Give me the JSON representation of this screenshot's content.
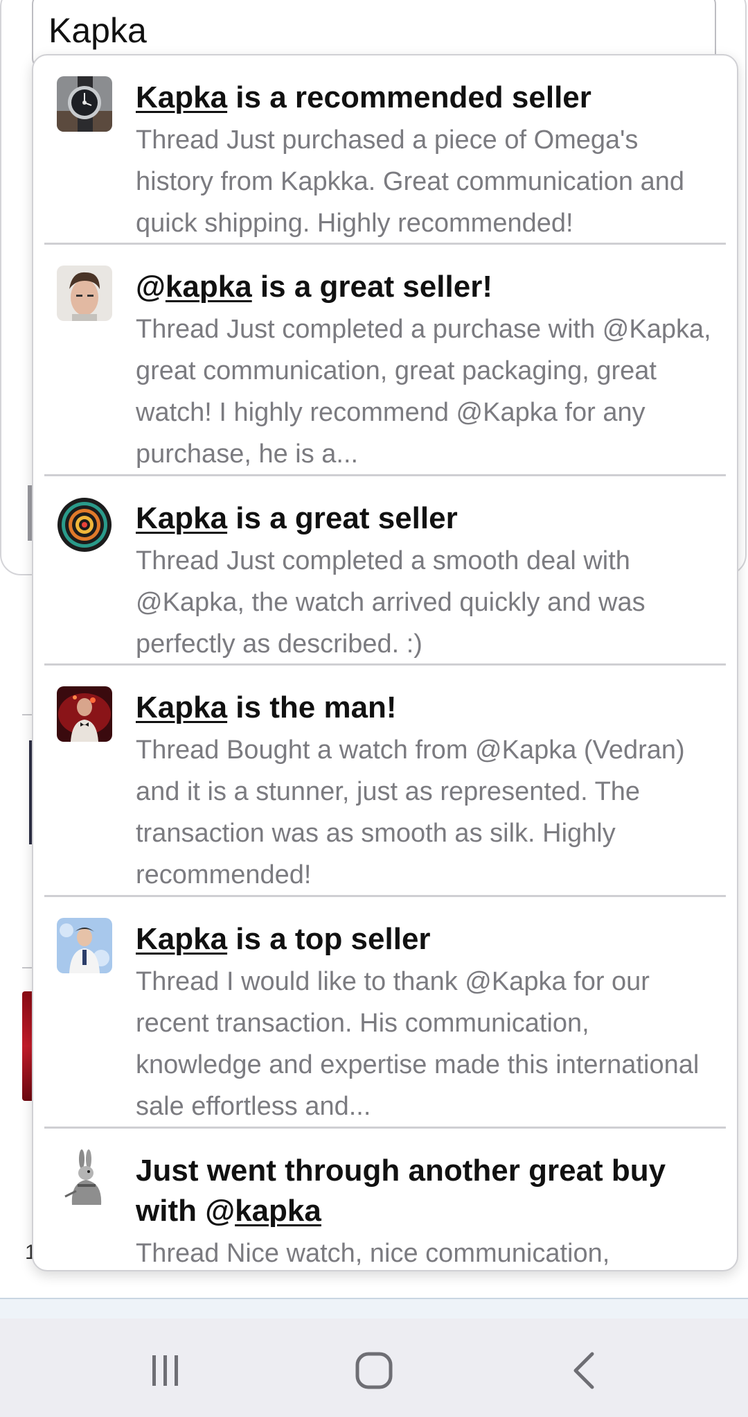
{
  "search": {
    "value": "Kapka"
  },
  "background": {
    "digit": "1"
  },
  "results": [
    {
      "avatar": "watch-avatar",
      "title_pre": "",
      "title_link": "Kapka",
      "title_post": " is a recommended seller",
      "snippet": "Thread Just purchased a piece of Omega's history from Kapkka. Great communication and quick shipping. Highly recommended!"
    },
    {
      "avatar": "man-portrait-avatar",
      "title_pre": "@",
      "title_link": "kapka",
      "title_post": " is a great seller!",
      "snippet": "Thread Just completed a purchase with @Kapka, great communication, great packaging, great watch! I highly recommend @Kapka for any purchase, he is a..."
    },
    {
      "avatar": "spiral-avatar",
      "title_pre": "",
      "title_link": "Kapka",
      "title_post": " is a great seller",
      "snippet": "Thread Just completed a smooth deal with @Kapka, the watch arrived quickly and was perfectly as described. :)"
    },
    {
      "avatar": "red-figure-avatar",
      "title_pre": "",
      "title_link": "Kapka",
      "title_post": " is the man!",
      "snippet": "Thread Bought a watch from @Kapka (Vedran) and it is a stunner, just as represented. The transaction was as smooth as silk. Highly recommended!"
    },
    {
      "avatar": "blue-man-avatar",
      "title_pre": "",
      "title_link": "Kapka",
      "title_post": " is a top seller",
      "snippet": "Thread I would like to thank @Kapka for our recent transaction. His communication, knowledge and expertise made this international sale effortless and..."
    },
    {
      "avatar": "rabbit-sketch-avatar",
      "title_pre": "Just went through another great buy with @",
      "title_link": "kapka",
      "title_post": "",
      "snippet": "Thread Nice watch, nice communication,"
    }
  ],
  "navbar": {
    "recents_icon": "recent-apps-icon",
    "home_icon": "home-icon",
    "back_icon": "back-icon"
  }
}
